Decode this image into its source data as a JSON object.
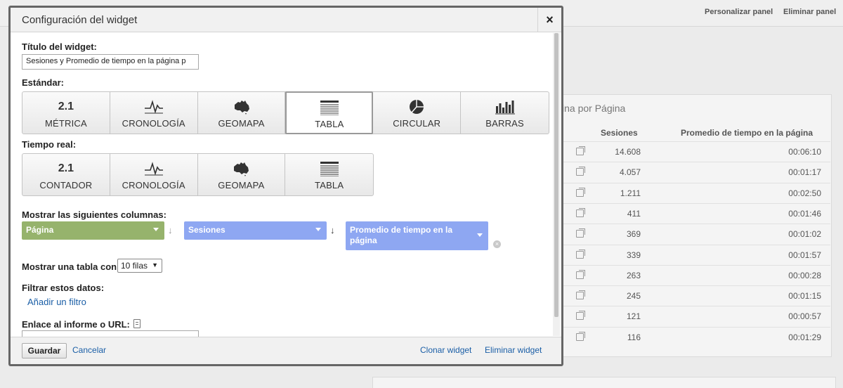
{
  "background": {
    "top_links": [
      "Personalizar panel",
      "Eliminar panel"
    ],
    "table_card": {
      "title_fragment": "ina por Página",
      "columns": [
        "Sesiones",
        "Promedio de tiempo en la página"
      ],
      "rows": [
        {
          "sesiones": "14.608",
          "tiempo": "00:06:10"
        },
        {
          "sesiones": "4.057",
          "tiempo": "00:01:17"
        },
        {
          "sesiones": "1.211",
          "tiempo": "00:02:50"
        },
        {
          "sesiones": "411",
          "tiempo": "00:01:46"
        },
        {
          "sesiones": "369",
          "tiempo": "00:01:02"
        },
        {
          "sesiones": "339",
          "tiempo": "00:01:57"
        },
        {
          "sesiones": "263",
          "tiempo": "00:00:28"
        },
        {
          "sesiones": "245",
          "tiempo": "00:01:15"
        },
        {
          "sesiones": "121",
          "tiempo": "00:00:57"
        },
        {
          "sesiones": "116",
          "tiempo": "00:01:29"
        }
      ]
    }
  },
  "modal": {
    "title": "Configuración del widget",
    "close_label": "×",
    "widget_title_label": "Título del widget:",
    "widget_title_value": "Sesiones y Promedio de tiempo en la página p",
    "standard_label": "Estándar:",
    "standard_options": [
      {
        "icon": "2.1",
        "label": "MÉTRICA"
      },
      {
        "icon": "timeline-icon",
        "label": "CRONOLOGÍA"
      },
      {
        "icon": "australia-map-icon",
        "label": "GEOMAPA"
      },
      {
        "icon": "table-icon",
        "label": "TABLA"
      },
      {
        "icon": "pie-icon",
        "label": "CIRCULAR"
      },
      {
        "icon": "bars-icon",
        "label": "BARRAS"
      }
    ],
    "standard_selected": "TABLA",
    "realtime_label": "Tiempo real:",
    "realtime_options": [
      {
        "icon": "2.1",
        "label": "CONTADOR"
      },
      {
        "icon": "timeline-icon",
        "label": "CRONOLOGÍA"
      },
      {
        "icon": "australia-map-icon",
        "label": "GEOMAPA"
      },
      {
        "icon": "table-icon",
        "label": "TABLA"
      }
    ],
    "columns_label": "Mostrar las siguientes columnas:",
    "columns": [
      {
        "label": "Página",
        "color": "#96b36c"
      },
      {
        "label": "Sesiones",
        "color": "#8ea7f2"
      },
      {
        "label": "Promedio de tiempo en la página",
        "color": "#8ea7f2"
      }
    ],
    "rows_label": "Mostrar una tabla con",
    "rows_value": "10 filas",
    "filter_label": "Filtrar estos datos:",
    "add_filter": "Añadir un filtro",
    "link_label": "Enlace al informe o URL:",
    "save": "Guardar",
    "cancel": "Cancelar",
    "clone": "Clonar widget",
    "delete": "Eliminar widget"
  }
}
